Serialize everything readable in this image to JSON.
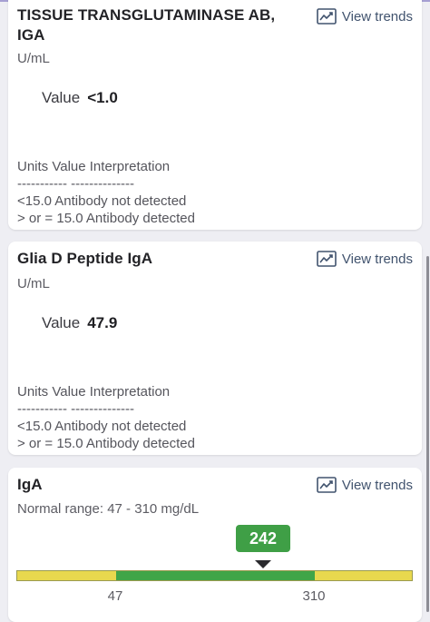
{
  "results": [
    {
      "title_line1": "TISSUE TRANSGLUTAMINASE AB,",
      "title_line2": "IGA",
      "units": "U/mL",
      "value_label": "Value",
      "value": "<1.0",
      "trends_label": "View trends",
      "interpretation": [
        "Units Value Interpretation",
        "----------- --------------",
        "<15.0 Antibody not detected",
        "> or = 15.0 Antibody detected"
      ]
    },
    {
      "title": "Glia D Peptide IgA",
      "units": "U/mL",
      "value_label": "Value",
      "value": "47.9",
      "trends_label": "View trends",
      "interpretation": [
        "Units Value Interpretation",
        "----------- --------------",
        "<15.0 Antibody not detected",
        "> or = 15.0 Antibody detected"
      ]
    },
    {
      "title": "IgA",
      "normal_range": "Normal range: 47 - 310 mg/dL",
      "trends_label": "View trends",
      "value": "242",
      "range_low": "47",
      "range_high": "310",
      "value_numeric": 242,
      "range_low_numeric": 47,
      "range_high_numeric": 310
    }
  ],
  "colors": {
    "in_range": "#40a548",
    "out_of_range": "#e8d84e",
    "badge": "#3f9f46",
    "link": "#41536e"
  },
  "icons": {
    "trends": "line-chart-icon"
  }
}
